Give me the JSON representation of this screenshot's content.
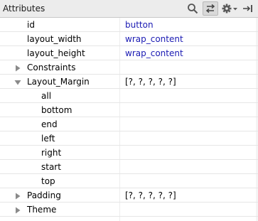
{
  "header": {
    "title": "Attributes",
    "icons": [
      "search-icon",
      "swap-icon",
      "gear-dropdown-icon",
      "pin-panel-icon"
    ]
  },
  "rows": [
    {
      "name": "id",
      "value": "button",
      "indent": 1,
      "expander": "none",
      "value_color": "#1a1ab3"
    },
    {
      "name": "layout_width",
      "value": "wrap_content",
      "indent": 1,
      "expander": "none",
      "value_color": "#1a1ab3"
    },
    {
      "name": "layout_height",
      "value": "wrap_content",
      "indent": 1,
      "expander": "none",
      "value_color": "#1a1ab3"
    },
    {
      "name": "Constraints",
      "value": "",
      "indent": 1,
      "expander": "collapsed"
    },
    {
      "name": "Layout_Margin",
      "value": "[?, ?, ?, ?, ?]",
      "indent": 1,
      "expander": "expanded"
    },
    {
      "name": "all",
      "value": "",
      "indent": 2,
      "expander": "none"
    },
    {
      "name": "bottom",
      "value": "",
      "indent": 2,
      "expander": "none"
    },
    {
      "name": "end",
      "value": "",
      "indent": 2,
      "expander": "none"
    },
    {
      "name": "left",
      "value": "",
      "indent": 2,
      "expander": "none"
    },
    {
      "name": "right",
      "value": "",
      "indent": 2,
      "expander": "none"
    },
    {
      "name": "start",
      "value": "",
      "indent": 2,
      "expander": "none"
    },
    {
      "name": "top",
      "value": "",
      "indent": 2,
      "expander": "none"
    },
    {
      "name": "Padding",
      "value": "[?, ?, ?, ?, ?]",
      "indent": 1,
      "expander": "collapsed"
    },
    {
      "name": "Theme",
      "value": "",
      "indent": 1,
      "expander": "collapsed"
    }
  ],
  "colors": {
    "value_blue": "#1a1ab3",
    "arrow_gray": "#8a8a8a",
    "header_bg": "#ececec"
  }
}
